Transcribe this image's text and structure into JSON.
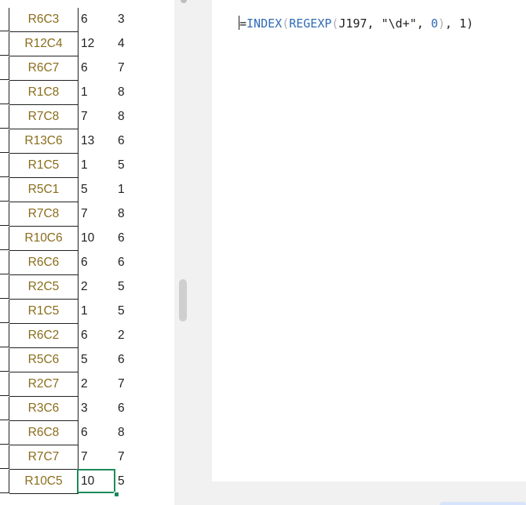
{
  "sheet": {
    "rows": [
      {
        "code": "R6C3",
        "a": "6",
        "b": "3"
      },
      {
        "code": "R12C4",
        "a": "12",
        "b": "4"
      },
      {
        "code": "R6C7",
        "a": "6",
        "b": "7"
      },
      {
        "code": "R1C8",
        "a": "1",
        "b": "8"
      },
      {
        "code": "R7C8",
        "a": "7",
        "b": "8"
      },
      {
        "code": "R13C6",
        "a": "13",
        "b": "6"
      },
      {
        "code": "R1C5",
        "a": "1",
        "b": "5"
      },
      {
        "code": "R5C1",
        "a": "5",
        "b": "1"
      },
      {
        "code": "R7C8",
        "a": "7",
        "b": "8"
      },
      {
        "code": "R10C6",
        "a": "10",
        "b": "6"
      },
      {
        "code": "R6C6",
        "a": "6",
        "b": "6"
      },
      {
        "code": "R2C5",
        "a": "2",
        "b": "5"
      },
      {
        "code": "R1C5",
        "a": "1",
        "b": "5"
      },
      {
        "code": "R6C2",
        "a": "6",
        "b": "2"
      },
      {
        "code": "R5C6",
        "a": "5",
        "b": "6"
      },
      {
        "code": "R2C7",
        "a": "2",
        "b": "7"
      },
      {
        "code": "R3C6",
        "a": "3",
        "b": "6"
      },
      {
        "code": "R6C8",
        "a": "6",
        "b": "8"
      },
      {
        "code": "R7C7",
        "a": "7",
        "b": "7"
      },
      {
        "code": "R10C5",
        "a": "10",
        "b": "5"
      }
    ]
  },
  "formula": {
    "eq": "=",
    "fn1": "INDEX",
    "open1": "(",
    "fn2": "REGEXP",
    "open2": "(",
    "ref": "J197, \"\\d+\", ",
    "zero": "0",
    "close2": ")",
    "rest": ", 1)"
  },
  "colors": {
    "code_text": "#8a6d1b",
    "selection_border": "#1e8a5a",
    "function_blue": "#2f6bb7"
  }
}
